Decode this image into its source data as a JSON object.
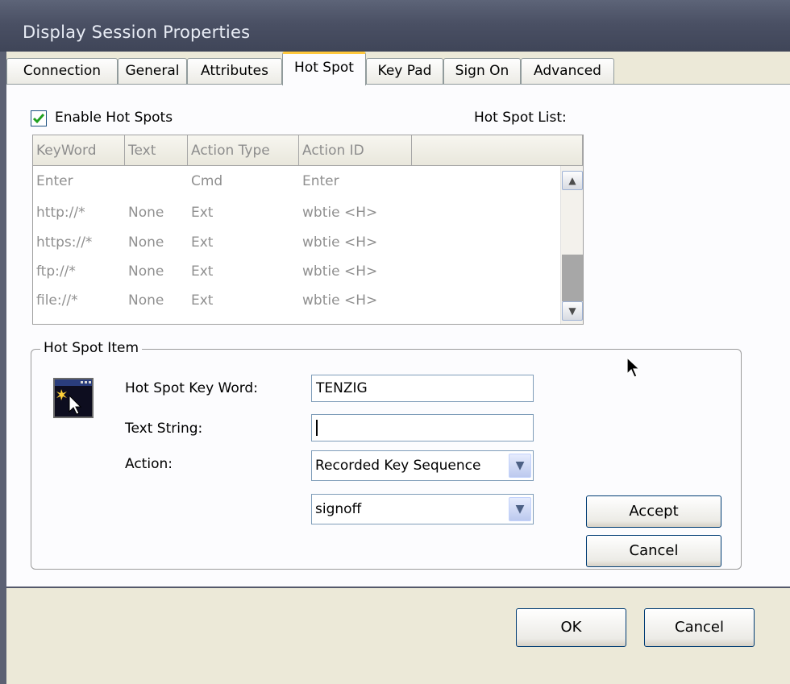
{
  "window": {
    "title": "Display Session Properties"
  },
  "tabs": [
    {
      "label": "Connection",
      "active": false
    },
    {
      "label": "General",
      "active": false
    },
    {
      "label": "Attributes",
      "active": false
    },
    {
      "label": "Hot Spot",
      "active": true
    },
    {
      "label": "Key Pad",
      "active": false
    },
    {
      "label": "Sign On",
      "active": false
    },
    {
      "label": "Advanced",
      "active": false
    }
  ],
  "hotspots": {
    "enable_label": "Enable Hot Spots",
    "enabled": true,
    "list_label": "Hot Spot List:",
    "columns": [
      "KeyWord",
      "Text",
      "Action Type",
      "Action ID"
    ],
    "rows": [
      {
        "keyword": "Enter",
        "text": "",
        "action_type": "Cmd",
        "action_id": "Enter"
      },
      {
        "keyword": "http://*",
        "text": "None",
        "action_type": "Ext",
        "action_id": "wbtie <H>"
      },
      {
        "keyword": "https://*",
        "text": "None",
        "action_type": "Ext",
        "action_id": "wbtie <H>"
      },
      {
        "keyword": "ftp://*",
        "text": "None",
        "action_type": "Ext",
        "action_id": "wbtie <H>"
      },
      {
        "keyword": "file://*",
        "text": "None",
        "action_type": "Ext",
        "action_id": "wbtie <H>"
      }
    ]
  },
  "item": {
    "group_title": "Hot Spot Item",
    "keyword_label": "Hot Spot Key Word:",
    "keyword_value": "TENZIG",
    "text_label": "Text String:",
    "text_value": "",
    "action_label": "Action:",
    "action_value": "Recorded Key Sequence",
    "action_id_value": "signoff",
    "accept_label": "Accept",
    "cancel_label": "Cancel"
  },
  "dialog": {
    "ok_label": "OK",
    "cancel_label": "Cancel"
  },
  "icons": {
    "checkbox": "checkmark-icon",
    "scroll_up": "scroll-up-arrow-icon",
    "scroll_down": "scroll-down-arrow-icon",
    "dropdown": "chevron-down-icon",
    "item": "hotspot-window-icon",
    "pointer": "mouse-cursor-icon"
  },
  "colors": {
    "titlebar": "#4a5064",
    "tab_highlight": "#ffc83c",
    "check": "#21a121",
    "panel": "#fcfcfe"
  }
}
